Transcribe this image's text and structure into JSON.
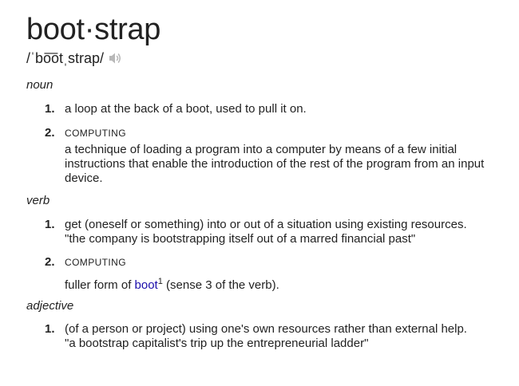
{
  "headword": "boot·strap",
  "pronunciation": "/ˈbo͞otˌstrap/",
  "speaker_icon": "speaker-icon",
  "sections": {
    "noun": {
      "label": "noun",
      "senses": [
        {
          "number": "1.",
          "definition": "a loop at the back of a boot, used to pull it on."
        },
        {
          "number": "2.",
          "domain": "COMPUTING",
          "definition": "a technique of loading a program into a computer by means of a few initial instructions that enable the introduction of the rest of the program from an input device."
        }
      ]
    },
    "verb": {
      "label": "verb",
      "senses": [
        {
          "number": "1.",
          "definition": "get (oneself or something) into or out of a situation using existing resources.",
          "example": "\"the company is bootstrapping itself out of a marred financial past\""
        },
        {
          "number": "2.",
          "domain": "COMPUTING",
          "definition_before": "fuller form of ",
          "link_text": "boot",
          "link_sup": "1",
          "definition_after": " (sense 3 of the verb)."
        }
      ]
    },
    "adjective": {
      "label": "adjective",
      "senses": [
        {
          "number": "1.",
          "definition": "(of a person or project) using one's own resources rather than external help.",
          "example": "\"a bootstrap capitalist's trip up the entrepreneurial ladder\""
        }
      ]
    }
  }
}
